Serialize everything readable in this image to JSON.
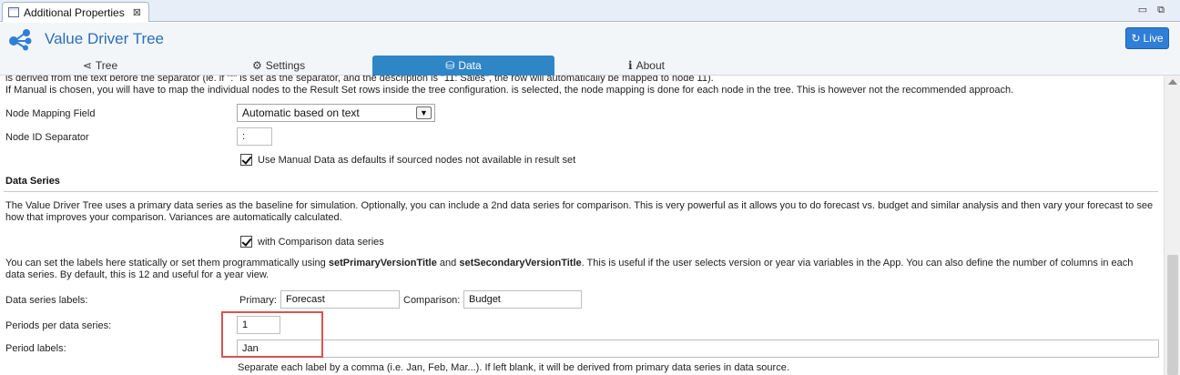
{
  "view_tab": {
    "title": "Additional Properties",
    "close": "⊠"
  },
  "window_controls": {
    "minimize": "▭",
    "maximize": "⧉"
  },
  "app": {
    "title": "Value Driver Tree",
    "live_label": "Live",
    "live_icon": "↻"
  },
  "tabs": [
    {
      "label": "Tree",
      "icon": "share-icon"
    },
    {
      "label": "Settings",
      "icon": "gear-icon"
    },
    {
      "label": "Data",
      "icon": "database-icon",
      "active": true
    },
    {
      "label": "About",
      "icon": "info-icon"
    }
  ],
  "tab_icons": {
    "tree": "⋖",
    "settings": "⚙",
    "data": "⛁",
    "about": "i"
  },
  "content": {
    "intro_line1": "is derived from the text before the separator (ie. if \":\" is set as the separator, and the description is \"11: Sales\", the row will automatically be mapped to node 11).",
    "intro_line2": "If Manual is chosen, you will have to map the individual nodes to the Result Set rows inside the tree configuration. is selected, the node mapping is done for each node in the tree. This is however not the recommended approach.",
    "node_mapping": {
      "label": "Node Mapping Field",
      "value": "Automatic based on text"
    },
    "node_id_separator": {
      "label": "Node ID Separator",
      "value": ":"
    },
    "manual_defaults_checkbox": "Use Manual Data as defaults if sourced nodes not available in result set",
    "data_series_heading": "Data Series",
    "data_series_desc_line1": "The Value Driver Tree uses a primary data series as the baseline for simulation. Optionally, you can include a 2nd data series for comparison. This is very powerful as it allows you to do forecast vs. budget and similar analysis and then vary your forecast to see",
    "data_series_desc_line2": "how that improves your comparison. Variances are automatically calculated.",
    "comparison_checkbox": "with Comparison data series",
    "labels_desc_line1_a": "You can set the labels here statically or set them programmatically using ",
    "labels_desc_line1_b": "setPrimaryVersionTitle",
    "labels_desc_line1_c": " and ",
    "labels_desc_line1_d": "setSecondaryVersionTitle",
    "labels_desc_line1_e": ". This is useful if the user selects version or year via variables in the App. You can also define the number of columns in each",
    "labels_desc_line2": "data series. By default, this is 12 and useful for a year view.",
    "series_labels": {
      "label": "Data series labels:",
      "primary_label": "Primary:",
      "primary_value": "Forecast",
      "comparison_label": "Comparison:",
      "comparison_value": "Budget"
    },
    "periods_per_series": {
      "label": "Periods per data series:",
      "value": "1"
    },
    "period_labels": {
      "label": "Period labels:",
      "value": "Jan"
    },
    "period_labels_hint": "Separate each label by a comma (i.e. Jan, Feb, Mar...). If left blank, it will be derived from primary data series in data source."
  },
  "colors": {
    "accent": "#2f86c6",
    "title": "#2a6ebb",
    "highlight": "#d9534f"
  }
}
